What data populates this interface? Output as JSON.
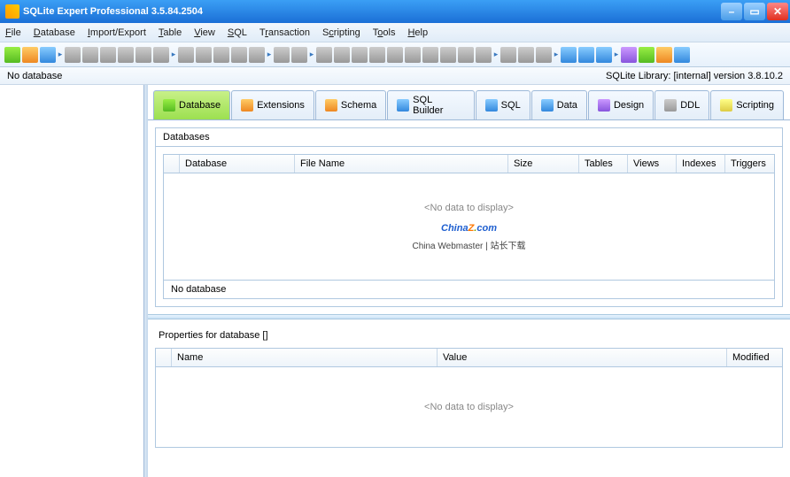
{
  "window": {
    "title": "SQLite Expert Professional 3.5.84.2504"
  },
  "menu": {
    "file": "File",
    "database": "Database",
    "import_export": "Import/Export",
    "table": "Table",
    "view": "View",
    "sql": "SQL",
    "transaction": "Transaction",
    "scripting": "Scripting",
    "tools": "Tools",
    "help": "Help"
  },
  "status": {
    "left": "No database",
    "right": "SQLite Library: [internal] version 3.8.10.2"
  },
  "tabs": [
    {
      "label": "Database",
      "active": true
    },
    {
      "label": "Extensions"
    },
    {
      "label": "Schema"
    },
    {
      "label": "SQL Builder"
    },
    {
      "label": "SQL"
    },
    {
      "label": "Data"
    },
    {
      "label": "Design"
    },
    {
      "label": "DDL"
    },
    {
      "label": "Scripting"
    }
  ],
  "top_panel": {
    "title": "Databases",
    "columns": [
      "Database",
      "File Name",
      "Size",
      "Tables",
      "Views",
      "Indexes",
      "Triggers"
    ],
    "empty_text": "<No data to display>",
    "footer": "No database"
  },
  "bottom_panel": {
    "title": "Properties for database []",
    "columns": [
      "Name",
      "Value",
      "Modified"
    ],
    "empty_text": "<No data to display>"
  },
  "watermark": {
    "brand_parts": [
      "China",
      "Z",
      ".",
      "com"
    ],
    "sub": "China Webmaster | 站长下载"
  }
}
